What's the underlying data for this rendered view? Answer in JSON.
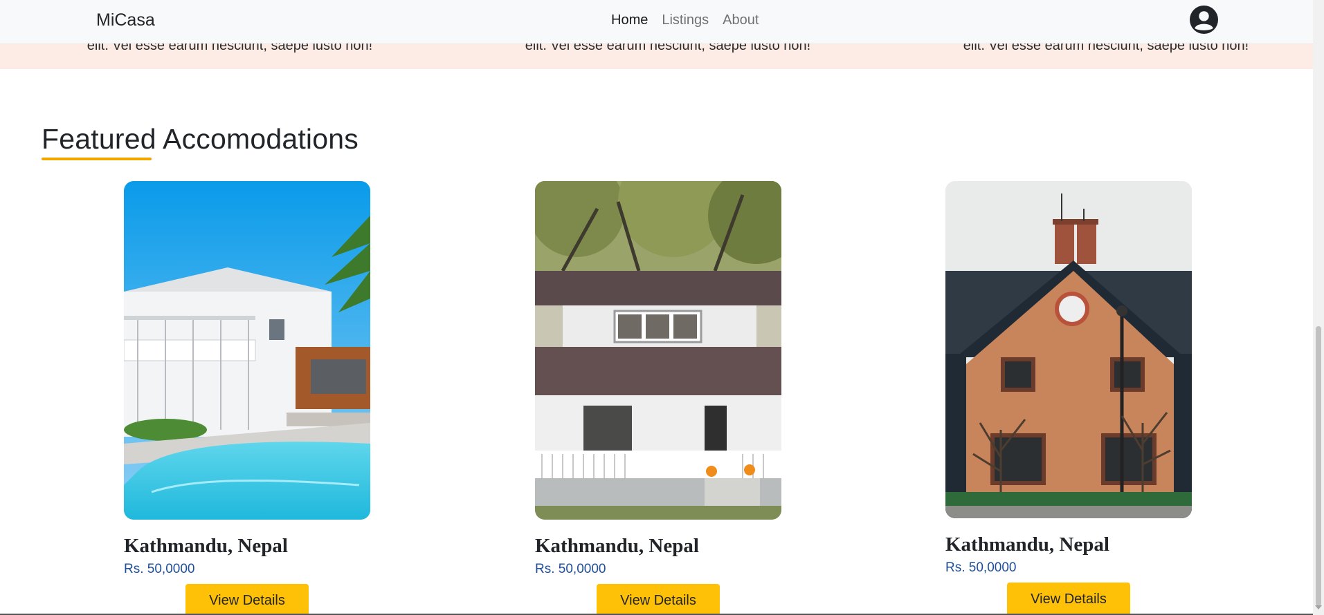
{
  "navbar": {
    "brand": "MiCasa",
    "links": [
      {
        "label": "Home",
        "active": true
      },
      {
        "label": "Listings",
        "active": false
      },
      {
        "label": "About",
        "active": false
      }
    ],
    "avatar_icon": "user-circle-icon"
  },
  "testimonials": {
    "snippets": [
      "elit. Vel esse earum nesciunt, saepe iusto non!",
      "elit. Vel esse earum nesciunt, saepe iusto non!",
      "elit. Vel esse earum nesciunt, saepe iusto non!"
    ]
  },
  "featured": {
    "title": "Featured Accomodations",
    "accent_color": "#f0a500",
    "cards": [
      {
        "location": "Kathmandu, Nepal",
        "price": "Rs. 50,0000",
        "button": "View Details",
        "image": "white-villa-with-pool-photo"
      },
      {
        "location": "Kathmandu, Nepal",
        "price": "Rs. 50,0000",
        "button": "View Details",
        "image": "white-house-with-porch-photo"
      },
      {
        "location": "Kathmandu, Nepal",
        "price": "Rs. 50,0000",
        "button": "View Details",
        "image": "brick-house-photo"
      }
    ]
  },
  "colors": {
    "button": "#ffc107",
    "price": "#1f4e9a",
    "navbar_bg": "#f8f9fa",
    "testimonial_bg": "#fdece6"
  }
}
